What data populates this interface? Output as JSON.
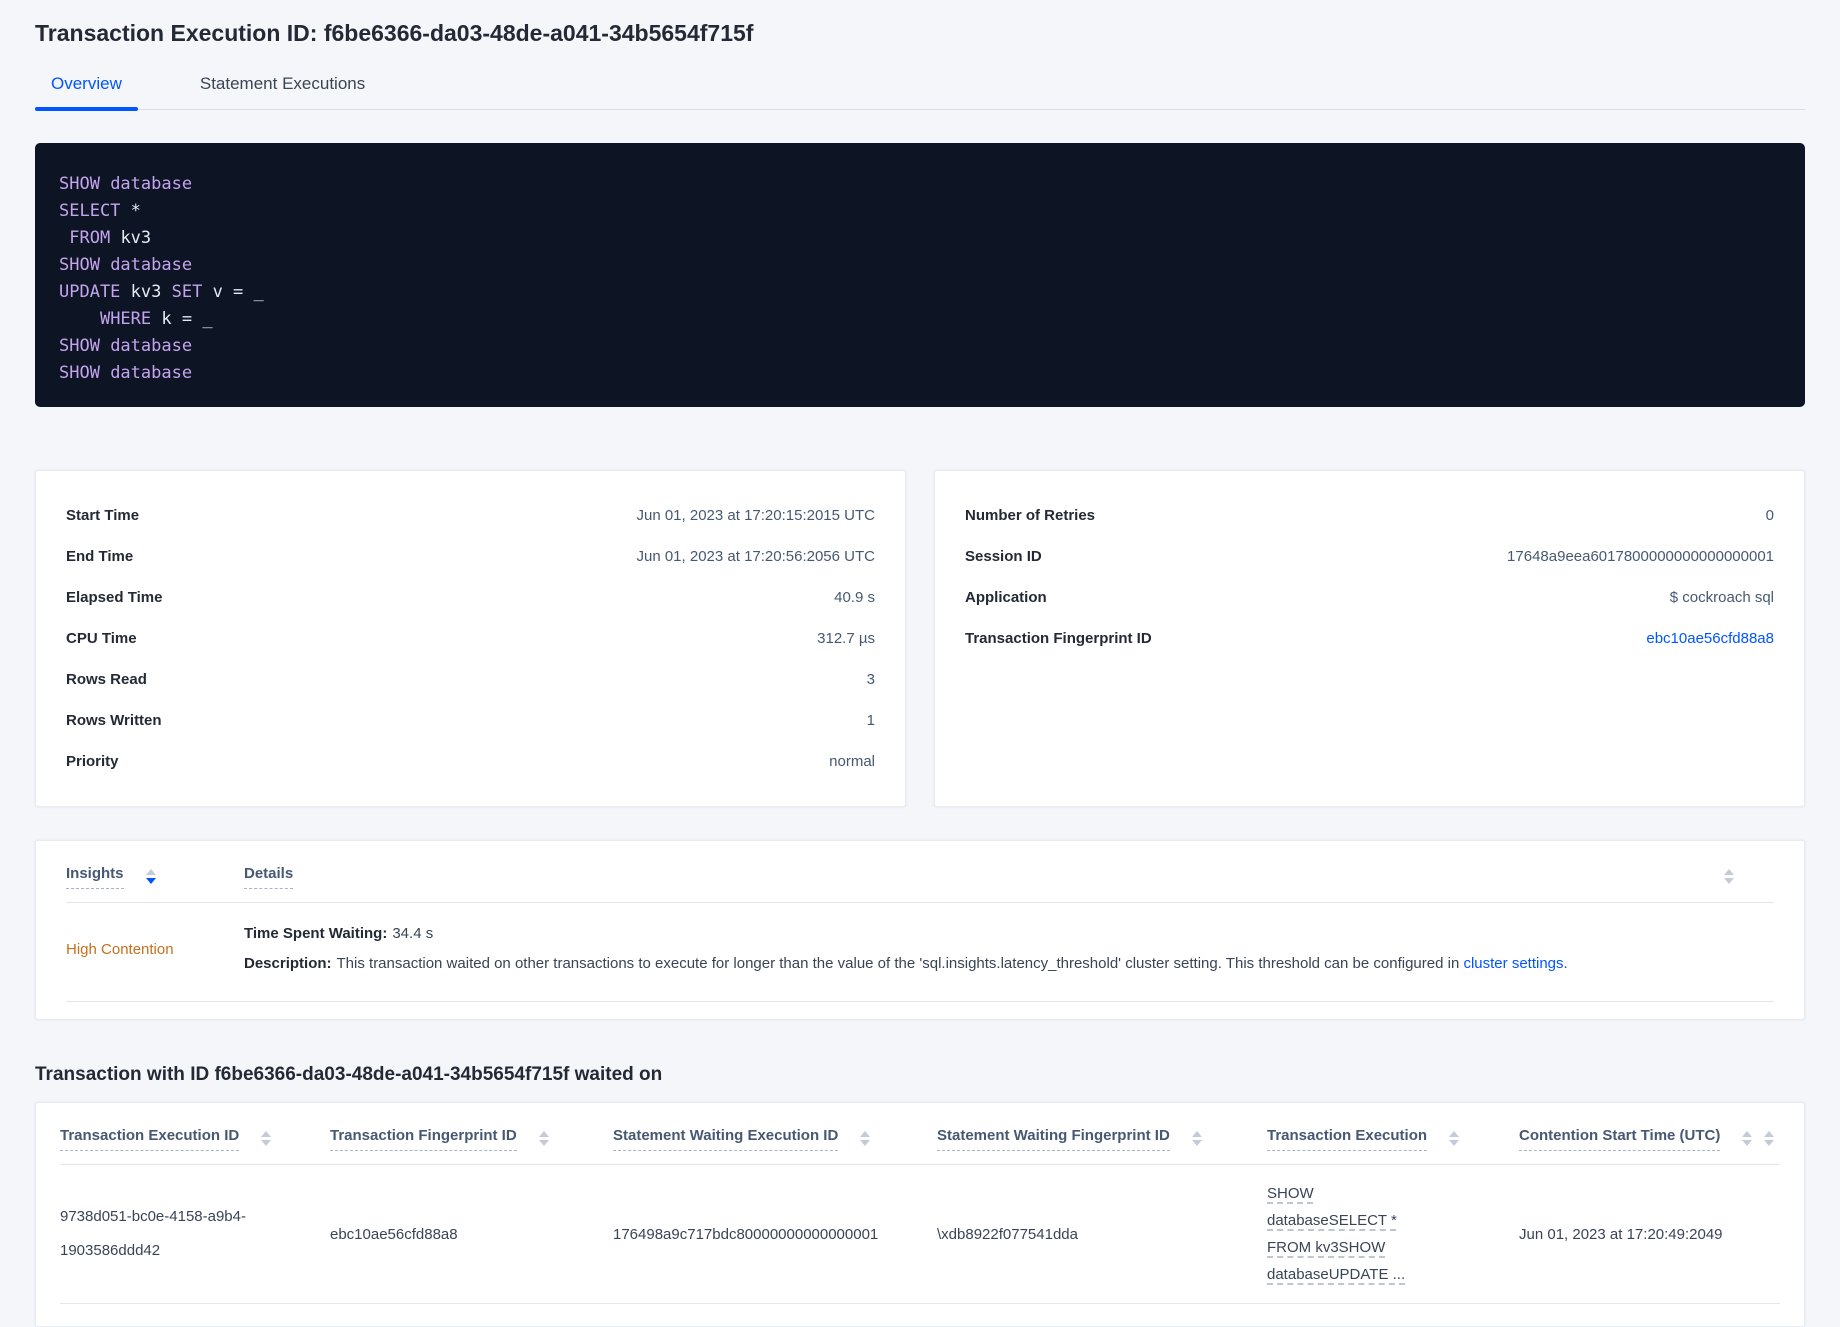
{
  "header": {
    "title": "Transaction Execution ID: f6be6366-da03-48de-a041-34b5654f715f"
  },
  "tabs": [
    {
      "label": "Overview"
    },
    {
      "label": "Statement Executions"
    }
  ],
  "sql": {
    "lines": [
      {
        "tokens": [
          {
            "text": "SHOW "
          },
          {
            "text": "database"
          }
        ]
      },
      {
        "tokens": [
          {
            "text": "SELECT "
          },
          {
            "text": "*"
          }
        ]
      },
      {
        "tokens": [
          {
            "text": " "
          },
          {
            "text": "FROM "
          },
          {
            "text": "kv3"
          }
        ]
      },
      {
        "tokens": [
          {
            "text": "SHOW "
          },
          {
            "text": "database"
          }
        ]
      },
      {
        "tokens": [
          {
            "text": "UPDATE "
          },
          {
            "text": "kv3 "
          },
          {
            "text": "SET "
          },
          {
            "text": "v = _"
          }
        ]
      },
      {
        "tokens": [
          {
            "text": "    "
          },
          {
            "text": "WHERE "
          },
          {
            "text": "k = _"
          }
        ]
      },
      {
        "tokens": [
          {
            "text": "SHOW "
          },
          {
            "text": "database"
          }
        ]
      },
      {
        "tokens": [
          {
            "text": "SHOW "
          },
          {
            "text": "database"
          }
        ]
      }
    ]
  },
  "details_left": {
    "rows": [
      {
        "label": "Start Time",
        "value": "Jun 01, 2023 at 17:20:15:2015 UTC"
      },
      {
        "label": "End Time",
        "value": "Jun 01, 2023 at 17:20:56:2056 UTC"
      },
      {
        "label": "Elapsed Time",
        "value": "40.9 s"
      },
      {
        "label": "CPU Time",
        "value": "312.7 µs"
      },
      {
        "label": "Rows Read",
        "value": "3"
      },
      {
        "label": "Rows Written",
        "value": "1"
      },
      {
        "label": "Priority",
        "value": "normal"
      }
    ]
  },
  "details_right": {
    "rows": [
      {
        "label": "Number of Retries",
        "value": "0"
      },
      {
        "label": "Session ID",
        "value": "17648a9eea6017800000000000000001"
      },
      {
        "label": "Application",
        "value": "$ cockroach sql"
      },
      {
        "label": "Transaction Fingerprint ID",
        "value": "ebc10ae56cfd88a8"
      }
    ]
  },
  "insights_table": {
    "columns": {
      "insights": "Insights",
      "details": "Details"
    },
    "row": {
      "insight": "High Contention",
      "waiting_label": "Time Spent Waiting:",
      "waiting_value": "34.4 s",
      "description_label": "Description:",
      "description_text": "This transaction waited on other transactions to execute for longer than the value of the 'sql.insights.latency_threshold' cluster setting. This threshold can be configured in",
      "description_link": "cluster settings",
      "description_suffix": "."
    }
  },
  "waited_on": {
    "heading": "Transaction with ID f6be6366-da03-48de-a041-34b5654f715f waited on",
    "columns": [
      "Transaction Execution ID",
      "Transaction Fingerprint ID",
      "Statement Waiting Execution ID",
      "Statement Waiting Fingerprint ID",
      "Transaction Execution",
      "Contention Start Time (UTC)"
    ],
    "rows": [
      {
        "transaction_execution_id": "9738d051-bc0e-4158-a9b4-1903586ddd42",
        "transaction_fingerprint_id": "ebc10ae56cfd88a8",
        "statement_waiting_execution_id": "176498a9c717bdc80000000000000001",
        "statement_waiting_fingerprint_id": "\\xdb8922f077541dda",
        "transaction_execution": "SHOW databaseSELECT * FROM kv3SHOW databaseUPDATE ...",
        "contention_start_time": "Jun 01, 2023 at 17:20:49:2049"
      }
    ]
  },
  "colors": {
    "accent_blue": "#0055ff",
    "insight_orange": "#c7701b",
    "code_keyword": "#c5a4ef",
    "code_background": "#0d1424"
  }
}
